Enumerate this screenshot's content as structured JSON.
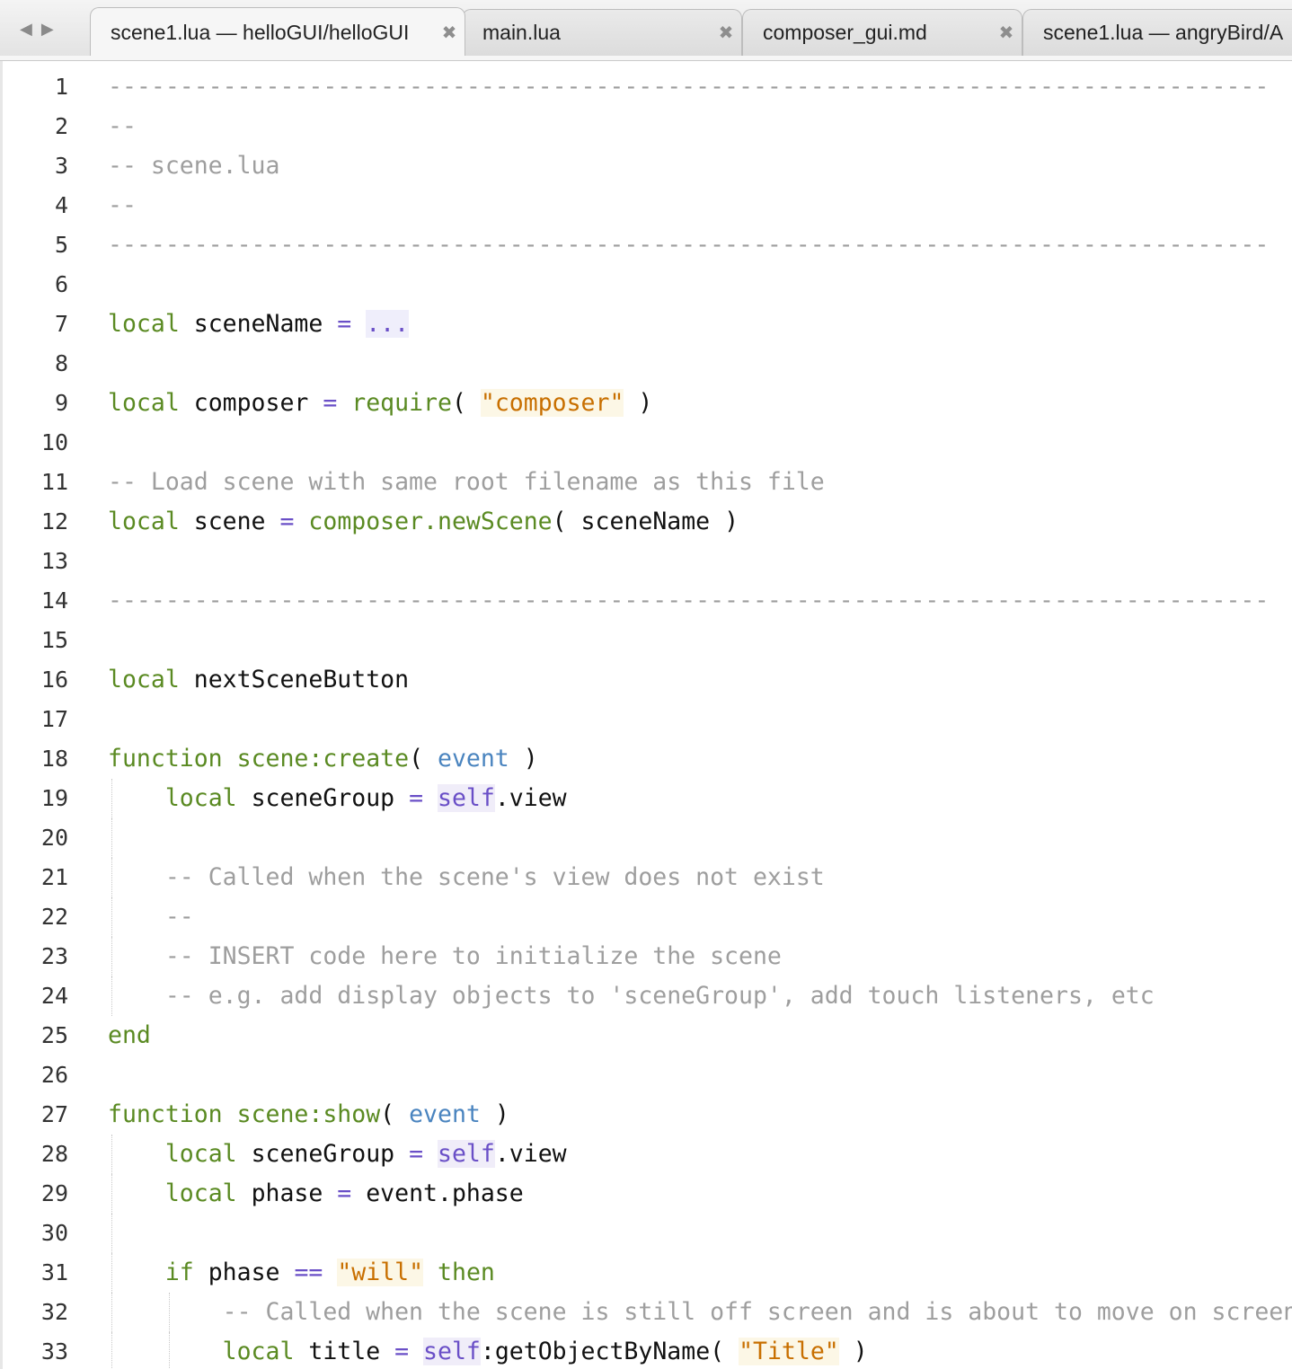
{
  "tabs": [
    {
      "label": "scene1.lua — helloGUI/helloGUI",
      "active": true,
      "close": "✖"
    },
    {
      "label": "main.lua",
      "active": false,
      "close": "✖"
    },
    {
      "label": "composer_gui.md",
      "active": false,
      "close": "✖"
    },
    {
      "label": "scene1.lua — angryBird/A",
      "active": false,
      "close": ""
    }
  ],
  "nav": {
    "back": "◀",
    "forward": "▶"
  },
  "lines": [
    {
      "n": "1",
      "tokens": [
        [
          "cm",
          "---------------------------------------------------------------------------------"
        ]
      ]
    },
    {
      "n": "2",
      "tokens": [
        [
          "cm",
          "--"
        ]
      ]
    },
    {
      "n": "3",
      "tokens": [
        [
          "cm",
          "-- scene.lua"
        ]
      ]
    },
    {
      "n": "4",
      "tokens": [
        [
          "cm",
          "--"
        ]
      ]
    },
    {
      "n": "5",
      "tokens": [
        [
          "cm",
          "---------------------------------------------------------------------------------"
        ]
      ]
    },
    {
      "n": "6",
      "tokens": []
    },
    {
      "n": "7",
      "tokens": [
        [
          "kw",
          "local"
        ],
        [
          "id",
          " sceneName "
        ],
        [
          "op",
          "="
        ],
        [
          "id",
          " "
        ],
        [
          "dots",
          "..."
        ]
      ]
    },
    {
      "n": "8",
      "tokens": []
    },
    {
      "n": "9",
      "tokens": [
        [
          "kw",
          "local"
        ],
        [
          "id",
          " composer "
        ],
        [
          "op",
          "="
        ],
        [
          "id",
          " "
        ],
        [
          "fn",
          "require"
        ],
        [
          "id",
          "( "
        ],
        [
          "st",
          "\"composer\""
        ],
        [
          "id",
          " )"
        ]
      ]
    },
    {
      "n": "10",
      "tokens": []
    },
    {
      "n": "11",
      "tokens": [
        [
          "cm",
          "-- Load scene with same root filename as this file"
        ]
      ]
    },
    {
      "n": "12",
      "tokens": [
        [
          "kw",
          "local"
        ],
        [
          "id",
          " scene "
        ],
        [
          "op",
          "="
        ],
        [
          "id",
          " "
        ],
        [
          "fn",
          "composer.newScene"
        ],
        [
          "id",
          "( sceneName )"
        ]
      ]
    },
    {
      "n": "13",
      "tokens": []
    },
    {
      "n": "14",
      "tokens": [
        [
          "cm",
          "---------------------------------------------------------------------------------"
        ]
      ]
    },
    {
      "n": "15",
      "tokens": []
    },
    {
      "n": "16",
      "tokens": [
        [
          "kw",
          "local"
        ],
        [
          "id",
          " nextSceneButton"
        ]
      ]
    },
    {
      "n": "17",
      "tokens": []
    },
    {
      "n": "18",
      "tokens": [
        [
          "kw",
          "function"
        ],
        [
          "id",
          " "
        ],
        [
          "fn",
          "scene:create"
        ],
        [
          "id",
          "( "
        ],
        [
          "va",
          "event"
        ],
        [
          "id",
          " )"
        ]
      ]
    },
    {
      "n": "19",
      "tokens": [
        [
          "id",
          "    "
        ],
        [
          "kw",
          "local"
        ],
        [
          "id",
          " sceneGroup "
        ],
        [
          "op",
          "="
        ],
        [
          "id",
          " "
        ],
        [
          "self",
          "self"
        ],
        [
          "id",
          ".view"
        ]
      ]
    },
    {
      "n": "20",
      "tokens": []
    },
    {
      "n": "21",
      "tokens": [
        [
          "id",
          "    "
        ],
        [
          "cm",
          "-- Called when the scene's view does not exist"
        ]
      ]
    },
    {
      "n": "22",
      "tokens": [
        [
          "id",
          "    "
        ],
        [
          "cm",
          "--"
        ]
      ]
    },
    {
      "n": "23",
      "tokens": [
        [
          "id",
          "    "
        ],
        [
          "cm",
          "-- INSERT code here to initialize the scene"
        ]
      ]
    },
    {
      "n": "24",
      "tokens": [
        [
          "id",
          "    "
        ],
        [
          "cm",
          "-- e.g. add display objects to 'sceneGroup', add touch listeners, etc"
        ]
      ]
    },
    {
      "n": "25",
      "tokens": [
        [
          "kw",
          "end"
        ]
      ]
    },
    {
      "n": "26",
      "tokens": []
    },
    {
      "n": "27",
      "tokens": [
        [
          "kw",
          "function"
        ],
        [
          "id",
          " "
        ],
        [
          "fn",
          "scene:show"
        ],
        [
          "id",
          "( "
        ],
        [
          "va",
          "event"
        ],
        [
          "id",
          " )"
        ]
      ]
    },
    {
      "n": "28",
      "tokens": [
        [
          "id",
          "    "
        ],
        [
          "kw",
          "local"
        ],
        [
          "id",
          " sceneGroup "
        ],
        [
          "op",
          "="
        ],
        [
          "id",
          " "
        ],
        [
          "self",
          "self"
        ],
        [
          "id",
          ".view"
        ]
      ]
    },
    {
      "n": "29",
      "tokens": [
        [
          "id",
          "    "
        ],
        [
          "kw",
          "local"
        ],
        [
          "id",
          " phase "
        ],
        [
          "op",
          "="
        ],
        [
          "id",
          " event.phase"
        ]
      ]
    },
    {
      "n": "30",
      "tokens": []
    },
    {
      "n": "31",
      "tokens": [
        [
          "id",
          "    "
        ],
        [
          "kw",
          "if"
        ],
        [
          "id",
          " phase "
        ],
        [
          "op",
          "=="
        ],
        [
          "id",
          " "
        ],
        [
          "st",
          "\"will\""
        ],
        [
          "id",
          " "
        ],
        [
          "kw",
          "then"
        ]
      ]
    },
    {
      "n": "32",
      "tokens": [
        [
          "id",
          "        "
        ],
        [
          "cm",
          "-- Called when the scene is still off screen and is about to move on screen"
        ]
      ]
    },
    {
      "n": "33",
      "tokens": [
        [
          "id",
          "        "
        ],
        [
          "kw",
          "local"
        ],
        [
          "id",
          " title "
        ],
        [
          "op",
          "="
        ],
        [
          "id",
          " "
        ],
        [
          "self",
          "self"
        ],
        [
          "id",
          ":getObjectByName( "
        ],
        [
          "st",
          "\"Title\""
        ],
        [
          "id",
          " )"
        ]
      ]
    }
  ]
}
